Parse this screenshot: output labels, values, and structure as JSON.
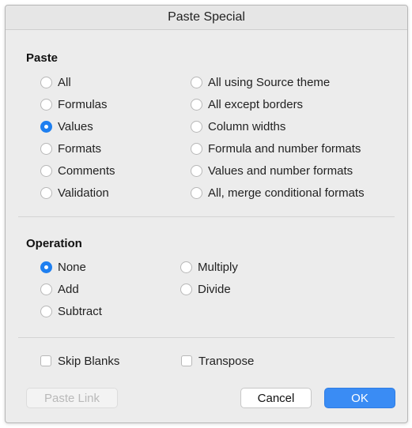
{
  "header_strip": {
    "text": "· ·· ···· · ········ · ··· ········ · · ·······"
  },
  "dialog": {
    "title": "Paste Special",
    "paste": {
      "heading": "Paste",
      "left": [
        {
          "label": "All",
          "checked": false
        },
        {
          "label": "Formulas",
          "checked": false
        },
        {
          "label": "Values",
          "checked": true
        },
        {
          "label": "Formats",
          "checked": false
        },
        {
          "label": "Comments",
          "checked": false
        },
        {
          "label": "Validation",
          "checked": false
        }
      ],
      "right": [
        {
          "label": "All using Source theme",
          "checked": false
        },
        {
          "label": "All except borders",
          "checked": false
        },
        {
          "label": "Column widths",
          "checked": false
        },
        {
          "label": "Formula and number formats",
          "checked": false
        },
        {
          "label": "Values and number formats",
          "checked": false
        },
        {
          "label": "All, merge conditional formats",
          "checked": false
        }
      ]
    },
    "operation": {
      "heading": "Operation",
      "left": [
        {
          "label": "None",
          "checked": true
        },
        {
          "label": "Add",
          "checked": false
        },
        {
          "label": "Subtract",
          "checked": false
        }
      ],
      "right": [
        {
          "label": "Multiply",
          "checked": false
        },
        {
          "label": "Divide",
          "checked": false
        }
      ]
    },
    "options": {
      "skip_blanks": {
        "label": "Skip Blanks",
        "checked": false
      },
      "transpose": {
        "label": "Transpose",
        "checked": false
      }
    },
    "buttons": {
      "paste_link": "Paste Link",
      "cancel": "Cancel",
      "ok": "OK"
    }
  },
  "colors": {
    "accent": "#1e7ff0",
    "ok_button": "#3a8cf4",
    "dialog_bg": "#ececec"
  }
}
